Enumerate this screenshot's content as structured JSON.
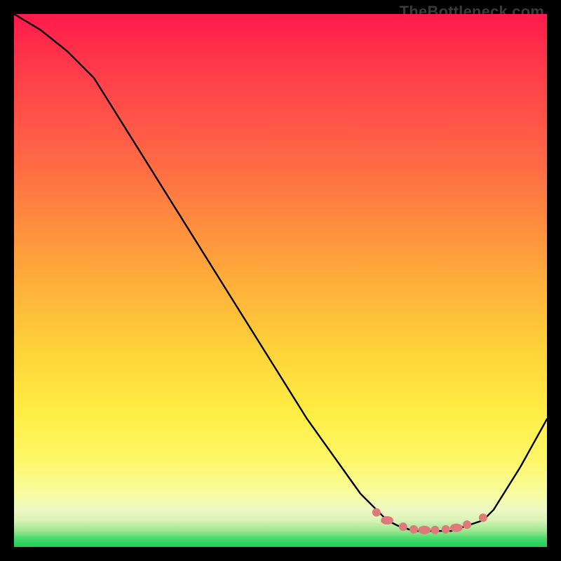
{
  "watermark": "TheBottleneck.com",
  "colors": {
    "curve_stroke": "#000000",
    "marker_fill": "#e07a7a",
    "marker_stroke": "#d66a6a"
  },
  "chart_data": {
    "type": "line",
    "title": "",
    "xlabel": "",
    "ylabel": "",
    "xlim": [
      0,
      100
    ],
    "ylim": [
      0,
      100
    ],
    "series": [
      {
        "name": "bottleneck-curve",
        "x": [
          0,
          5,
          10,
          15,
          20,
          25,
          30,
          35,
          40,
          45,
          50,
          55,
          60,
          65,
          68,
          70,
          72,
          75,
          78,
          80,
          82,
          85,
          88,
          90,
          95,
          100
        ],
        "y": [
          100,
          97,
          93,
          88,
          80,
          72,
          64,
          56,
          48,
          40,
          32,
          24,
          17,
          10,
          7,
          5,
          4,
          3,
          3,
          3,
          3,
          4,
          5,
          7,
          15,
          24
        ]
      }
    ],
    "markers": {
      "name": "optimal-range-dots",
      "x": [
        68,
        70,
        73,
        75,
        77,
        79,
        81,
        83,
        85,
        88
      ],
      "y": [
        6.5,
        5.0,
        3.8,
        3.3,
        3.2,
        3.2,
        3.3,
        3.6,
        4.2,
        5.5
      ]
    }
  }
}
